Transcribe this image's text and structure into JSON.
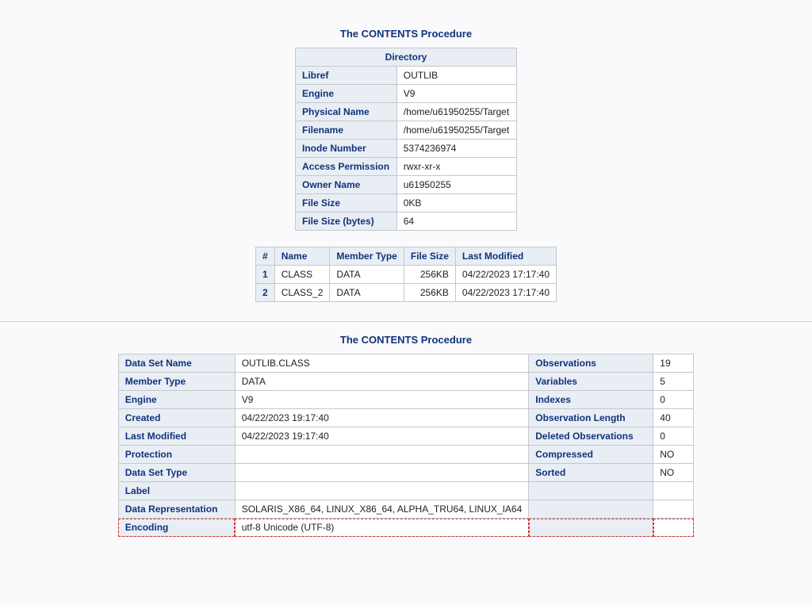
{
  "section1": {
    "title": "The CONTENTS Procedure",
    "directory": {
      "header": "Directory",
      "rows": [
        {
          "label": "Libref",
          "value": "OUTLIB"
        },
        {
          "label": "Engine",
          "value": "V9"
        },
        {
          "label": "Physical Name",
          "value": "/home/u61950255/Target"
        },
        {
          "label": "Filename",
          "value": "/home/u61950255/Target"
        },
        {
          "label": "Inode Number",
          "value": "5374236974"
        },
        {
          "label": "Access Permission",
          "value": "rwxr-xr-x"
        },
        {
          "label": "Owner Name",
          "value": "u61950255"
        },
        {
          "label": "File Size",
          "value": "0KB"
        },
        {
          "label": "File Size (bytes)",
          "value": "64"
        }
      ]
    },
    "members": {
      "headers": {
        "idx": "#",
        "name": "Name",
        "type": "Member Type",
        "size": "File Size",
        "modified": "Last Modified"
      },
      "rows": [
        {
          "idx": "1",
          "name": "CLASS",
          "type": "DATA",
          "size": "256KB",
          "modified": "04/22/2023 17:17:40"
        },
        {
          "idx": "2",
          "name": "CLASS_2",
          "type": "DATA",
          "size": "256KB",
          "modified": "04/22/2023 17:17:40"
        }
      ]
    }
  },
  "section2": {
    "title": "The CONTENTS Procedure",
    "details": {
      "rows": [
        {
          "l1": "Data Set Name",
          "v1": "OUTLIB.CLASS",
          "l2": "Observations",
          "v2": "19"
        },
        {
          "l1": "Member Type",
          "v1": "DATA",
          "l2": "Variables",
          "v2": "5"
        },
        {
          "l1": "Engine",
          "v1": "V9",
          "l2": "Indexes",
          "v2": "0"
        },
        {
          "l1": "Created",
          "v1": "04/22/2023 19:17:40",
          "l2": "Observation Length",
          "v2": "40"
        },
        {
          "l1": "Last Modified",
          "v1": "04/22/2023 19:17:40",
          "l2": "Deleted Observations",
          "v2": "0"
        },
        {
          "l1": "Protection",
          "v1": "",
          "l2": "Compressed",
          "v2": "NO"
        },
        {
          "l1": "Data Set Type",
          "v1": "",
          "l2": "Sorted",
          "v2": "NO"
        },
        {
          "l1": "Label",
          "v1": "",
          "l2": "",
          "v2": ""
        },
        {
          "l1": "Data Representation",
          "v1": "SOLARIS_X86_64, LINUX_X86_64, ALPHA_TRU64, LINUX_IA64",
          "l2": "",
          "v2": ""
        },
        {
          "l1": "Encoding",
          "v1": "utf-8 Unicode (UTF-8)",
          "l2": "",
          "v2": "",
          "highlight": true
        }
      ]
    }
  }
}
